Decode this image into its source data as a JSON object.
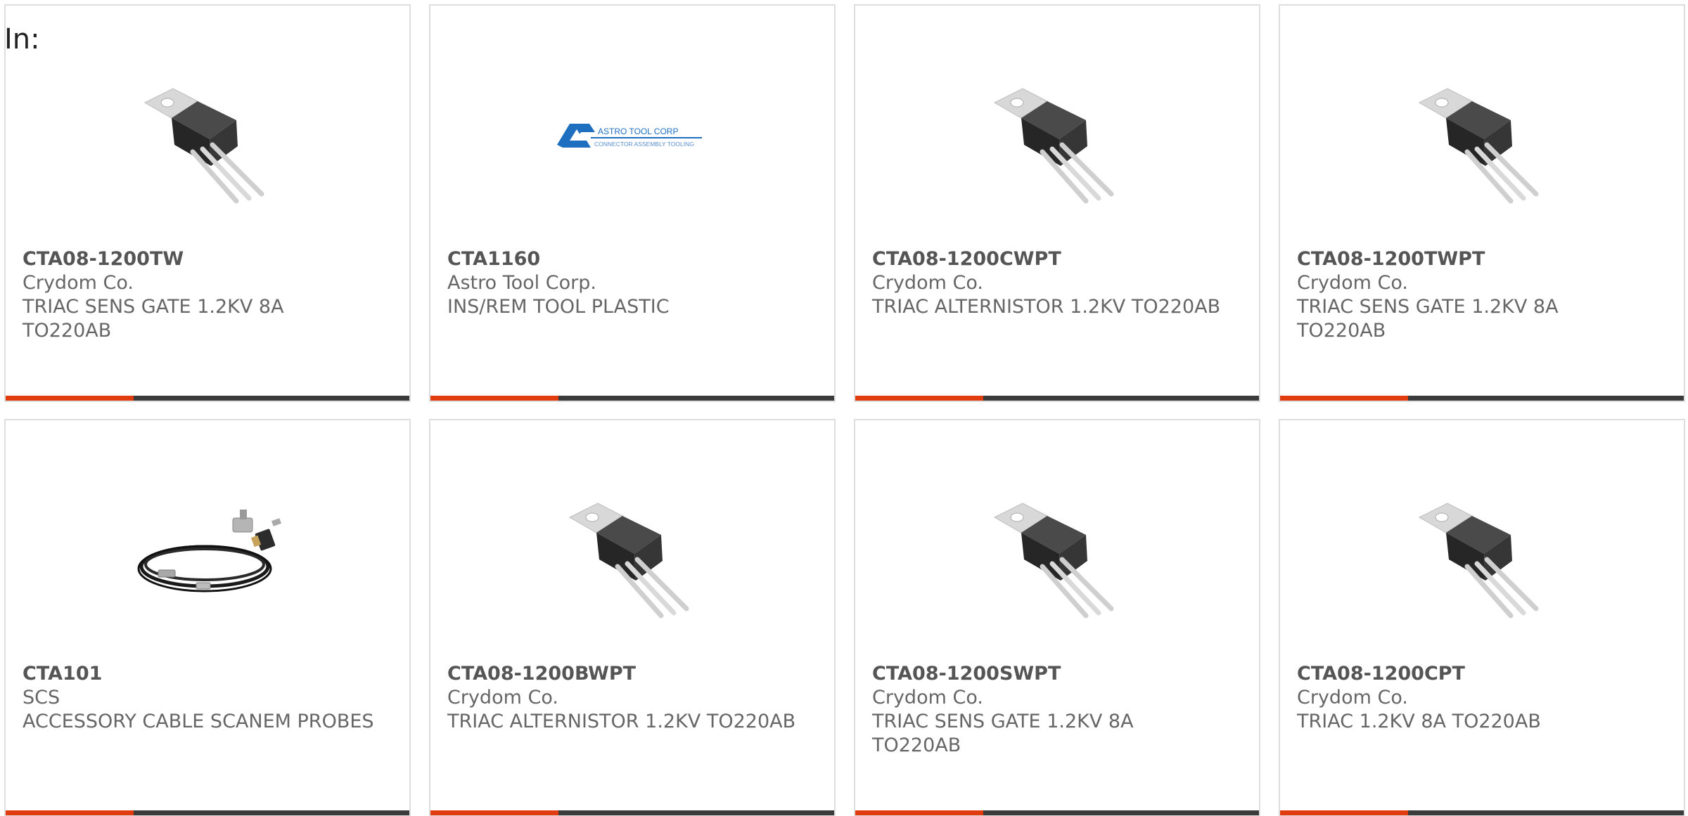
{
  "filter_label": "In:",
  "colors": {
    "accent": "#e03c10",
    "bar": "#3b3b3b",
    "border": "#dedede",
    "logo_blue": "#1f6fc0"
  },
  "products": [
    {
      "part_number": "CTA08-1200TW",
      "manufacturer": "Crydom Co.",
      "description": "TRIAC SENS GATE 1.2KV 8A TO220AB",
      "image": "to220-transistor-icon"
    },
    {
      "part_number": "CTA1160",
      "manufacturer": "Astro Tool Corp.",
      "description": "INS/REM TOOL PLASTIC",
      "image": "astro-tool-logo",
      "logo_title": "ASTRO TOOL CORP",
      "logo_subtitle": "CONNECTOR ASSEMBLY TOOLING"
    },
    {
      "part_number": "CTA08-1200CWPT",
      "manufacturer": "Crydom Co.",
      "description": "TRIAC ALTERNISTOR 1.2KV TO220AB",
      "image": "to220-transistor-icon"
    },
    {
      "part_number": "CTA08-1200TWPT",
      "manufacturer": "Crydom Co.",
      "description": "TRIAC SENS GATE 1.2KV 8A TO220AB",
      "image": "to220-transistor-icon"
    },
    {
      "part_number": "CTA101",
      "manufacturer": "SCS",
      "description": "ACCESSORY CABLE SCANEM PROBES",
      "image": "coax-cable-icon"
    },
    {
      "part_number": "CTA08-1200BWPT",
      "manufacturer": "Crydom Co.",
      "description": "TRIAC ALTERNISTOR 1.2KV TO220AB",
      "image": "to220-transistor-icon"
    },
    {
      "part_number": "CTA08-1200SWPT",
      "manufacturer": "Crydom Co.",
      "description": "TRIAC SENS GATE 1.2KV 8A TO220AB",
      "image": "to220-transistor-icon"
    },
    {
      "part_number": "CTA08-1200CPT",
      "manufacturer": "Crydom Co.",
      "description": "TRIAC 1.2KV 8A TO220AB",
      "image": "to220-transistor-icon"
    }
  ]
}
